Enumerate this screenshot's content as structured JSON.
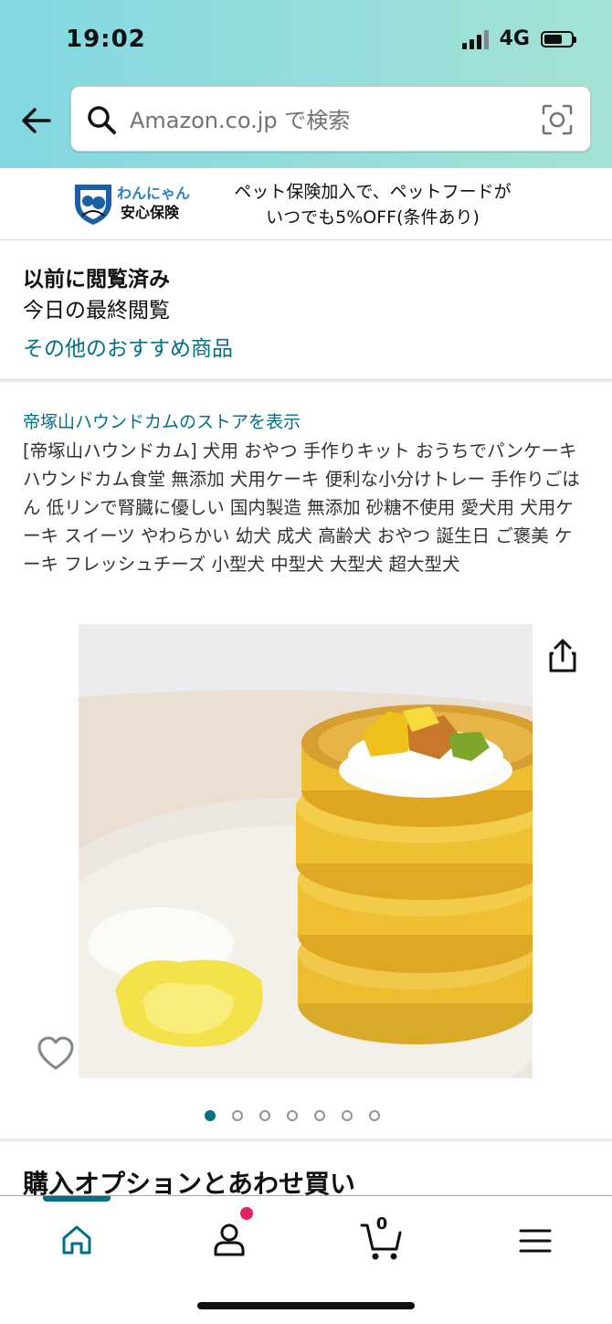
{
  "status_bar": {
    "time": "19:02",
    "network": "4G",
    "battery_level": 0.72
  },
  "search": {
    "placeholder": "Amazon.co.jp で検索"
  },
  "banner": {
    "brand_line1": "わんにゃん",
    "brand_line2": "安心保険",
    "text_line1": "ペット保険加入で、ペットフードが",
    "text_line2": "いつでも5%OFF(条件あり)"
  },
  "recently_viewed": {
    "title": "以前に閲覧済み",
    "subtitle": "今日の最終閲覧",
    "link": "その他のおすすめ商品"
  },
  "product": {
    "store_link": "帝塚山ハウンドカムのストアを表示",
    "title": "[帝塚山ハウンドカム] 犬用 おやつ 手作りキット おうちでパンケーキ ハウンドカム食堂 無添加 犬用ケーキ 便利な小分けトレー 手作りごはん 低リンで腎臓に優しい 国内製造 無添加 砂糖不使用 愛犬用 犬用ケーキ スイーツ やわらかい 幼犬 成犬 高齢犬 おやつ 誕生日 ご褒美 ケーキ フレッシュチーズ 小型犬 中型犬 大型犬 超大型犬",
    "image_count": 7,
    "active_image_index": 0
  },
  "section": {
    "options_title": "購入オプションとあわせ買い"
  },
  "bottom_nav": {
    "items": [
      "home-icon",
      "account-icon",
      "cart-icon",
      "menu-icon"
    ],
    "cart_count": "0",
    "active": "home"
  },
  "colors": {
    "accent": "#007185",
    "header_start": "#83d8e2",
    "header_end": "#a4e2d5",
    "notification": "#e0245e"
  }
}
